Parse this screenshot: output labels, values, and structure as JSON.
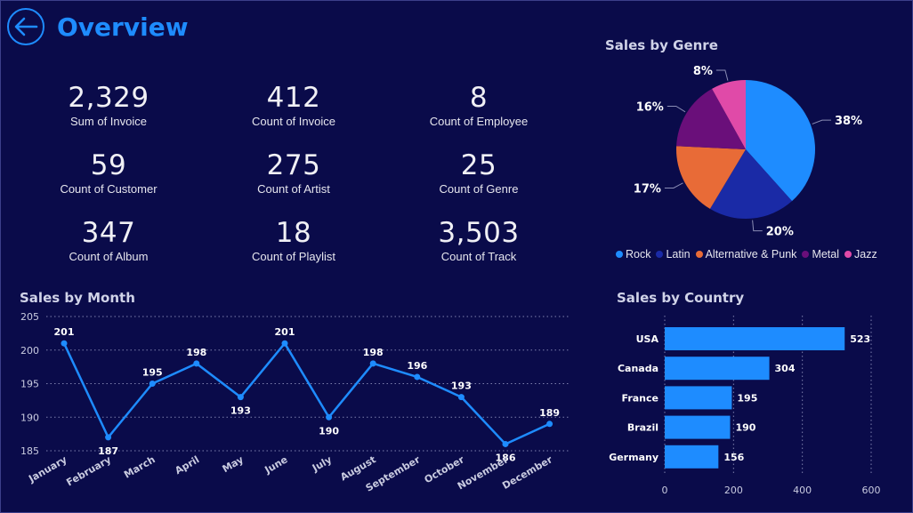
{
  "header": {
    "title": "Overview",
    "back_icon": "arrow-left-icon"
  },
  "kpis": [
    {
      "value": "2,329",
      "label": "Sum of Invoice"
    },
    {
      "value": "412",
      "label": "Count of Invoice"
    },
    {
      "value": "8",
      "label": "Count of Employee"
    },
    {
      "value": "59",
      "label": "Count of Customer"
    },
    {
      "value": "275",
      "label": "Count of Artist"
    },
    {
      "value": "25",
      "label": "Count of Genre"
    },
    {
      "value": "347",
      "label": "Count of Album"
    },
    {
      "value": "18",
      "label": "Count of Playlist"
    },
    {
      "value": "3,503",
      "label": "Count of Track"
    }
  ],
  "colors": {
    "background": "#0a0b4a",
    "accent": "#1e8cff",
    "rock": "#1e8cff",
    "latin": "#1a2aa6",
    "alternative": "#e86b37",
    "metal": "#6a0f7a",
    "jazz": "#e04aa8"
  },
  "chart_data": [
    {
      "type": "pie",
      "title": "Sales by Genre",
      "categories": [
        "Rock",
        "Latin",
        "Alternative & Punk",
        "Metal",
        "Jazz"
      ],
      "values": [
        38,
        20,
        17,
        16,
        8
      ],
      "labels": [
        "38%",
        "20%",
        "17%",
        "16%",
        "8%"
      ],
      "legend": "bottom"
    },
    {
      "type": "line",
      "title": "Sales by Month",
      "categories": [
        "January",
        "February",
        "March",
        "April",
        "May",
        "June",
        "July",
        "August",
        "September",
        "October",
        "November",
        "December"
      ],
      "values": [
        201,
        187,
        195,
        198,
        193,
        201,
        190,
        198,
        196,
        193,
        186,
        189
      ],
      "ylim": [
        185,
        205
      ],
      "yticks": [
        "185",
        "190",
        "195",
        "200",
        "205"
      ],
      "grid": true
    },
    {
      "type": "bar",
      "title": "Sales by Country",
      "orientation": "horizontal",
      "categories": [
        "USA",
        "Canada",
        "France",
        "Brazil",
        "Germany"
      ],
      "values": [
        523,
        304,
        195,
        190,
        156
      ],
      "xlim": [
        0,
        600
      ],
      "xticks": [
        "0",
        "200",
        "400",
        "600"
      ],
      "grid": true
    }
  ]
}
